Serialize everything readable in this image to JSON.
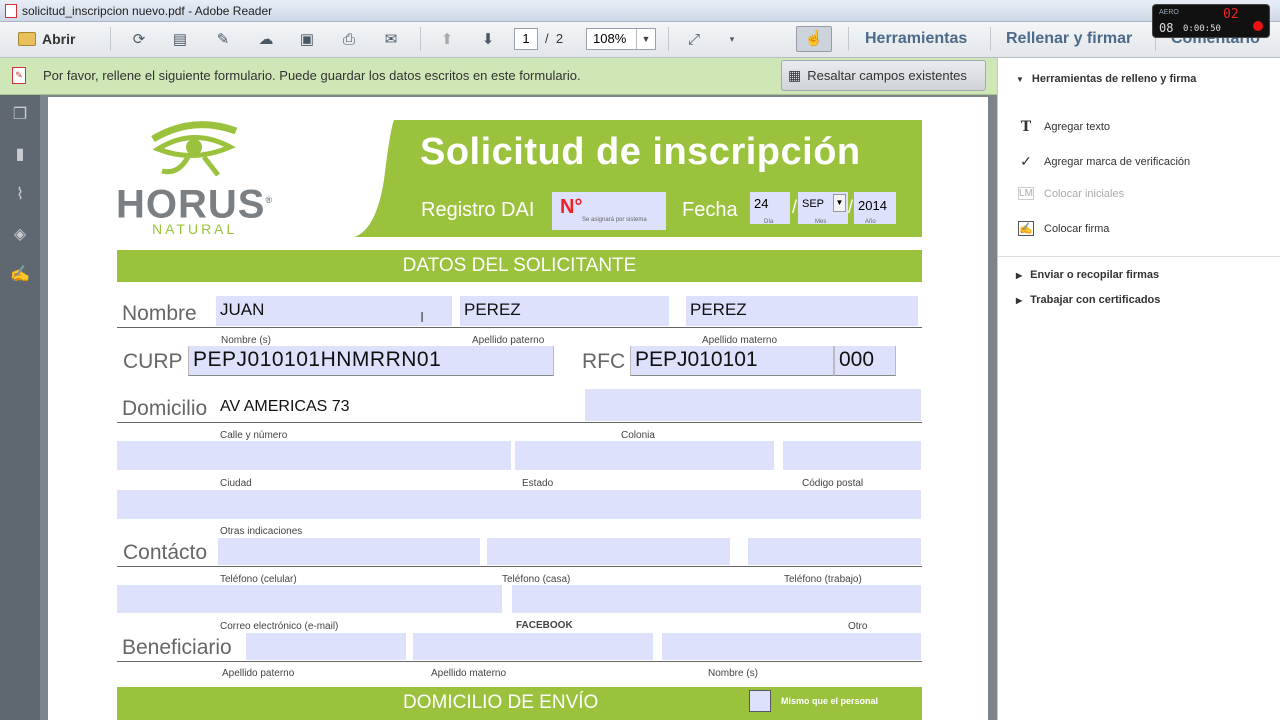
{
  "window": {
    "title": "solicitud_inscripcion nuevo.pdf - Adobe Reader"
  },
  "recorder": {
    "brand": "AERO",
    "count": "02",
    "elapsed": "08",
    "clock": "0:00:50"
  },
  "toolbar": {
    "open_label": "Abrir",
    "page_current": "1",
    "page_sep": "/",
    "page_total": "2",
    "zoom": "108%",
    "links": [
      "Herramientas",
      "Rellenar y firmar",
      "Comentario"
    ]
  },
  "notice": {
    "text": "Por favor, rellene el siguiente formulario. Puede guardar los datos escritos en este formulario.",
    "highlight_button": "Resaltar campos existentes"
  },
  "right_panel": {
    "section_title": "Herramientas de relleno y firma",
    "tools": [
      {
        "label": "Agregar texto",
        "icon": "text-T-icon",
        "enabled": true
      },
      {
        "label": "Agregar marca de verificación",
        "icon": "checkmark-icon",
        "enabled": true
      },
      {
        "label": "Colocar iniciales",
        "icon": "initials-icon",
        "enabled": false
      },
      {
        "label": "Colocar firma",
        "icon": "signature-icon",
        "enabled": true
      }
    ],
    "collapsed": [
      "Enviar o recopilar firmas",
      "Trabajar con certificados"
    ]
  },
  "form": {
    "logo_main": "HORUS",
    "logo_sub": "NATURAL",
    "logo_reg": "®",
    "title": "Solicitud de inscripción",
    "registro_label": "Registro DAI",
    "numero_label": "N°",
    "numero_hint": "Se asignará por sistema",
    "fecha_label": "Fecha",
    "fecha_dia": "24",
    "fecha_mes": "SEP",
    "fecha_anio": "2014",
    "fecha_dia_lbl": "Día",
    "fecha_mes_lbl": "Mes",
    "fecha_anio_lbl": "Año",
    "section1": "DATOS DEL SOLICITANTE",
    "nombre_label": "Nombre",
    "nombre": "JUAN",
    "ap_paterno": "PEREZ",
    "ap_materno": "PEREZ",
    "nombre_sub": "Nombre (s)",
    "ap_paterno_sub": "Apellido paterno",
    "ap_materno_sub": "Apellido materno",
    "curp_label": "CURP",
    "curp": "PEPJ010101HNMRRN01",
    "rfc_label": "RFC",
    "rfc": "PEPJ010101",
    "rfc_homo": "000",
    "domicilio_label": "Domicilio",
    "calle": "AV AMERICAS 73",
    "calle_sub": "Calle y número",
    "colonia_sub": "Colonia",
    "ciudad_sub": "Ciudad",
    "estado_sub": "Estado",
    "cp_sub": "Código postal",
    "otras_sub": "Otras indicaciones",
    "contacto_label": "Contácto",
    "tel_cel_sub": "Teléfono (celular)",
    "tel_casa_sub": "Teléfono (casa)",
    "tel_trab_sub": "Teléfono (trabajo)",
    "email_sub": "Correo electrónico (e-mail)",
    "facebook_sub": "FACEBOOK",
    "otro_sub": "Otro",
    "beneficiario_label": "Beneficiario",
    "ben_paterno_sub": "Apellido paterno",
    "ben_materno_sub": "Apellido materno",
    "ben_nombre_sub": "Nombre (s)",
    "section2": "DOMICILIO DE ENVÍO",
    "mismo_label": "Mismo que el personal"
  }
}
